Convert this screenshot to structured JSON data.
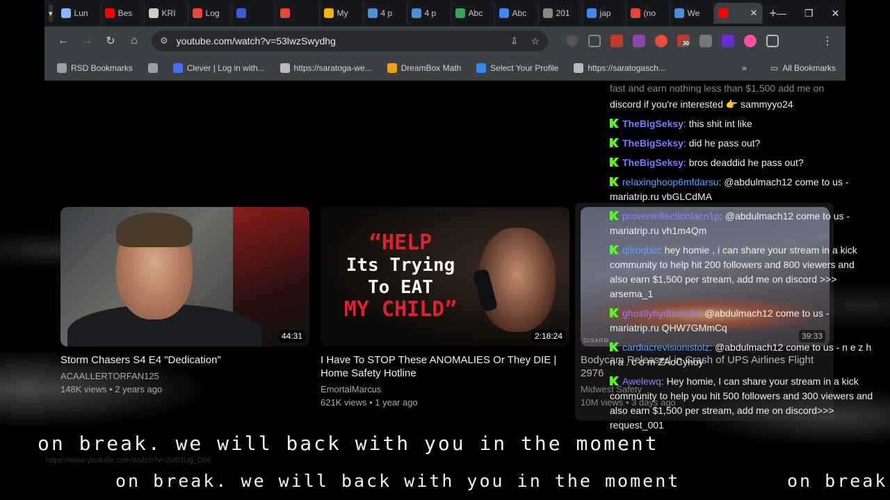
{
  "browser": {
    "tabs": [
      {
        "label": "Lun",
        "color": "#8ab4f8"
      },
      {
        "label": "Bes",
        "color": "#ff0000"
      },
      {
        "label": "KRI",
        "color": "#cccccc"
      },
      {
        "label": "Log",
        "color": "#e8453c"
      },
      {
        "label": "",
        "color": "#3b5bdb"
      },
      {
        "label": "",
        "color": "#e8453c"
      },
      {
        "label": "My",
        "color": "#f4b400"
      },
      {
        "label": "4 p",
        "color": "#4a90d9"
      },
      {
        "label": "4 p",
        "color": "#4a90d9"
      },
      {
        "label": "Abc",
        "color": "#34a853"
      },
      {
        "label": "Abc",
        "color": "#4285f4"
      },
      {
        "label": "201",
        "color": "#888888"
      },
      {
        "label": "jap",
        "color": "#4285f4"
      },
      {
        "label": "(no",
        "color": "#ea4335"
      },
      {
        "label": "We",
        "color": "#4a90d9"
      },
      {
        "label": "",
        "color": "#ff0000",
        "active": true
      }
    ],
    "url": "youtube.com/watch?v=53lwzSwydhg",
    "badge_count": "30",
    "bookmarks": [
      {
        "label": "RSD Bookmarks",
        "color": "#9aa0a6"
      },
      {
        "label": "",
        "color": "#9aa0a6"
      },
      {
        "label": "Clever | Log in with...",
        "color": "#4a6cf7"
      },
      {
        "label": "https://saratoga-we...",
        "color": "#bbbbbb"
      },
      {
        "label": "DreamBox Math",
        "color": "#f4a300"
      },
      {
        "label": "Select Your Profile",
        "color": "#2d8cf0"
      },
      {
        "label": "https://saratogasch...",
        "color": "#bbbbbb"
      }
    ],
    "all_bookmarks": "All Bookmarks"
  },
  "videos": [
    {
      "title": "Storm Chasers S4 E4 \"Dedication\"",
      "channel": "ACAALLERTORFAN125",
      "stats": "148K views • 2 years ago",
      "duration": "44:31"
    },
    {
      "title": "I Have To STOP These ANOMALIES Or They DIE | Home Safety Hotline",
      "channel": "EmortalMarcus",
      "stats": "621K views • 1 year ago",
      "duration": "2:18:24",
      "thumb_text": {
        "line1": "“HELP",
        "line2": "Its Trying",
        "line3": "To EAT",
        "line4": "MY CHILD”"
      }
    },
    {
      "title": "Bodycam Released in Crash of UPS Airlines Flight 2976",
      "channel": "Midwest Safety",
      "stats": "10M views • 3 days ago",
      "duration": "39:33",
      "thumb_tag": "DISARM"
    }
  ],
  "chat": {
    "top_fragment": "fast and earn nothing less than $1,500 add me on",
    "messages": [
      {
        "user": "",
        "text": "discord if you're interested 👉 sammyyo24",
        "continuation": true
      },
      {
        "user": "TheBigSeksy",
        "text": "this shit int like"
      },
      {
        "user": "TheBigSeksy",
        "text": "did he pass out?"
      },
      {
        "user": "TheBigSeksy",
        "text": "bros deaddid he pass out?"
      },
      {
        "user": "relaxinghoop6mfdarsu",
        "text": "@abdulmach12 come to us - mariatrip.ru vbGLCdMA"
      },
      {
        "user": "proveninflectionfacn1p",
        "text": "@abdulmach12 come to us - mariatrip.ru vh1m4Qm"
      },
      {
        "user": "qilroqbul",
        "text": "hey homie , i can share your stream in a kick community to help hit 200 followers and 800 viewers and also earn $1,500 per stream, add me on discord >>> arsema_1"
      },
      {
        "user": "ghostlyhydbrando",
        "text": "@abdulmach12 come to us - mariatrip.ru QHW7GMmCq"
      },
      {
        "user": "cardiacrevisionistolz",
        "text": "@abdulmach12 come to us - n e z h n a . c o m ZAoCyhoy"
      },
      {
        "user": "Awelewq",
        "text": "Hey homie, I can share your stream in a kick community to help you hit 500 followers and 300 viewers and also earn $1,500 per stream, add me on discord>>> request_001"
      }
    ]
  },
  "ticker": {
    "line1": "on break. we will back with you in the moment",
    "line2": "on break. we will back with you in the moment",
    "line3": "on break."
  },
  "hover_url": "https://www.youtube.com/watch?v=2wtl3Ug_D06"
}
